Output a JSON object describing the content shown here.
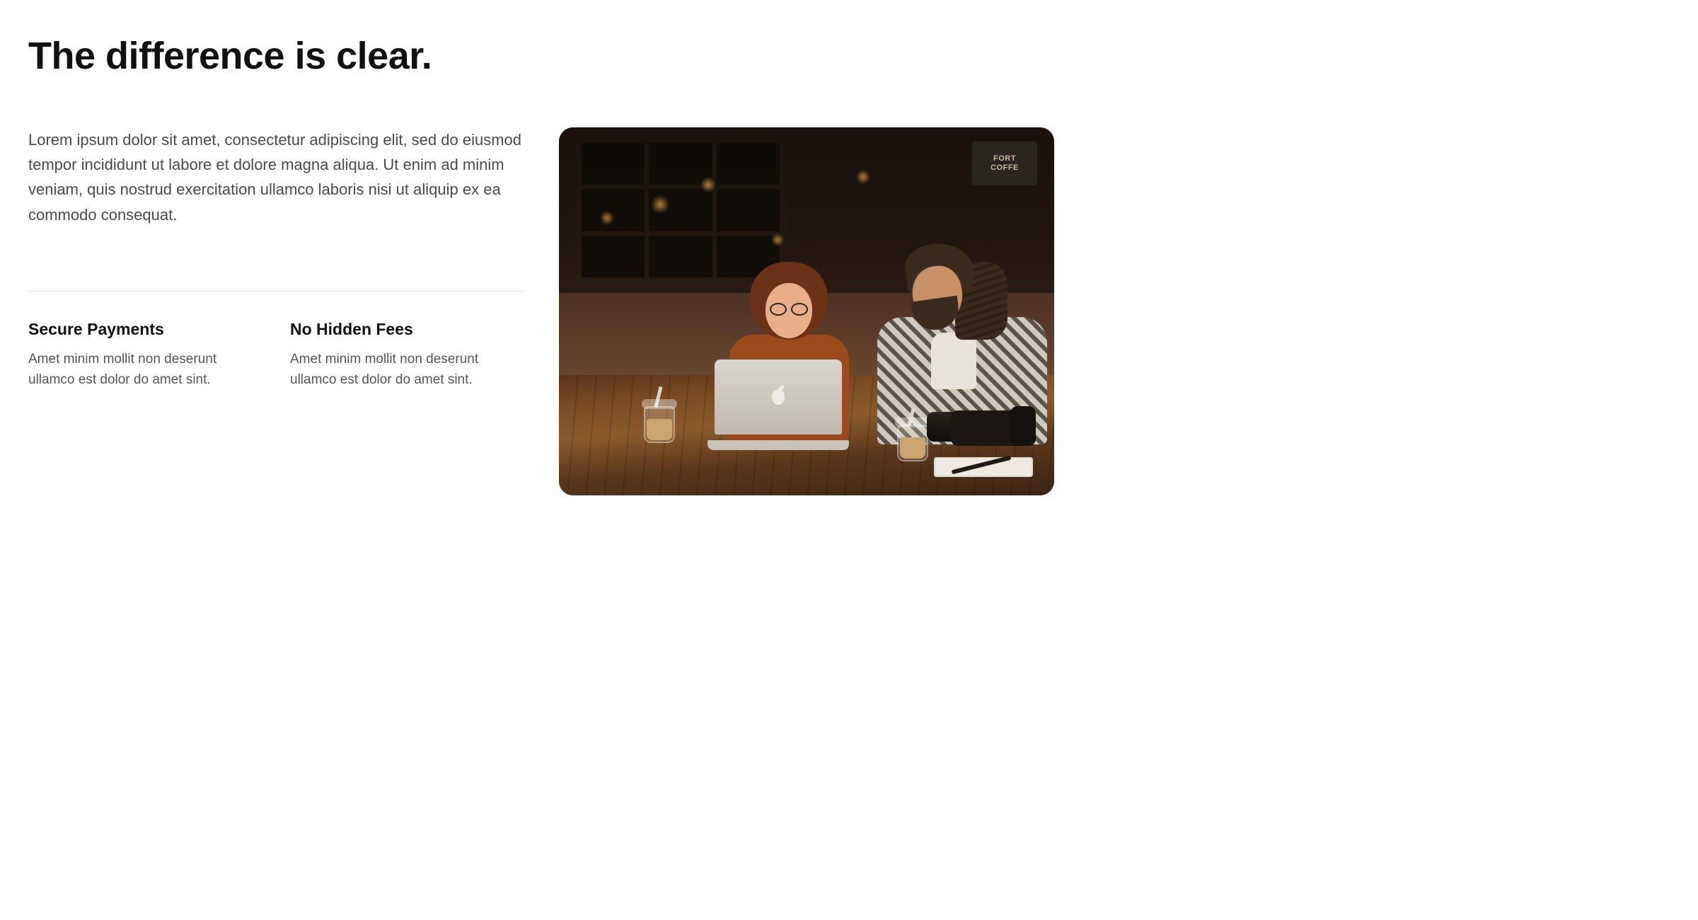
{
  "heading": "The difference is clear.",
  "lead": "Lorem ipsum dolor sit amet, consectetur adipiscing elit, sed do eiusmod tempor incididunt ut labore et dolore magna aliqua. Ut enim ad minim veniam, quis nostrud exercitation ullamco laboris nisi ut aliquip ex ea commodo consequat.",
  "features": [
    {
      "title": "Secure Payments",
      "desc": "Amet minim mollit non deserunt ullamco est dolor do amet sint."
    },
    {
      "title": "No Hidden Fees",
      "desc": "Amet minim mollit non deserunt ullamco est dolor do amet sint."
    }
  ],
  "image": {
    "alt": "Two people sitting at a wooden cafe table with a laptop, iced coffees, a camera and a notebook",
    "sign_line1": "FORT",
    "sign_line2": "COFFE"
  }
}
